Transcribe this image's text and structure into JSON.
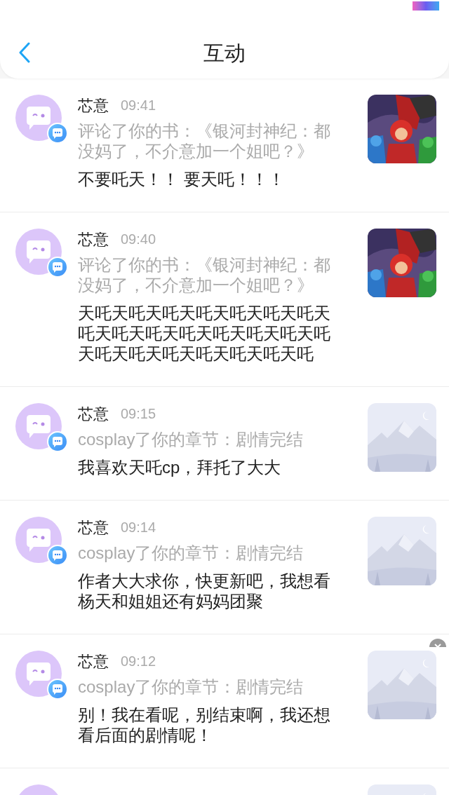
{
  "header": {
    "title": "互动"
  },
  "messages": [
    {
      "name": "芯意",
      "time": "09:41",
      "action": "评论了你的书：《银河封神纪：都没妈了，不介意加一个姐吧？》",
      "text": "不要吒天！！ 要天吒！！！",
      "thumbnail": {
        "kind": "cover"
      },
      "close_badge": false
    },
    {
      "name": "芯意",
      "time": "09:40",
      "action": "评论了你的书：《银河封神纪：都没妈了，不介意加一个姐吧？》",
      "text": "天吒天吒天吒天吒天吒天吒天吒天吒天吒天吒天吒天吒天吒天吒天吒天吒天吒天吒天吒天吒天吒天吒",
      "thumbnail": {
        "kind": "cover"
      },
      "close_badge": false
    },
    {
      "name": "芯意",
      "time": "09:15",
      "action": "cosplay了你的章节：剧情完结",
      "text": "我喜欢天吒cp，拜托了大大",
      "thumbnail": {
        "kind": "placeholder"
      },
      "close_badge": false
    },
    {
      "name": "芯意",
      "time": "09:14",
      "action": "cosplay了你的章节：剧情完结",
      "text": "作者大大求你，快更新吧，我想看杨天和姐姐还有妈妈团聚",
      "thumbnail": {
        "kind": "placeholder"
      },
      "close_badge": false
    },
    {
      "name": "芯意",
      "time": "09:12",
      "action": "cosplay了你的章节：剧情完结",
      "text": "别！我在看呢，别结束啊，我还想看后面的剧情呢！",
      "thumbnail": {
        "kind": "placeholder"
      },
      "close_badge": true
    },
    {
      "thumbnail": {
        "kind": "placeholder"
      },
      "close_badge": false
    }
  ]
}
